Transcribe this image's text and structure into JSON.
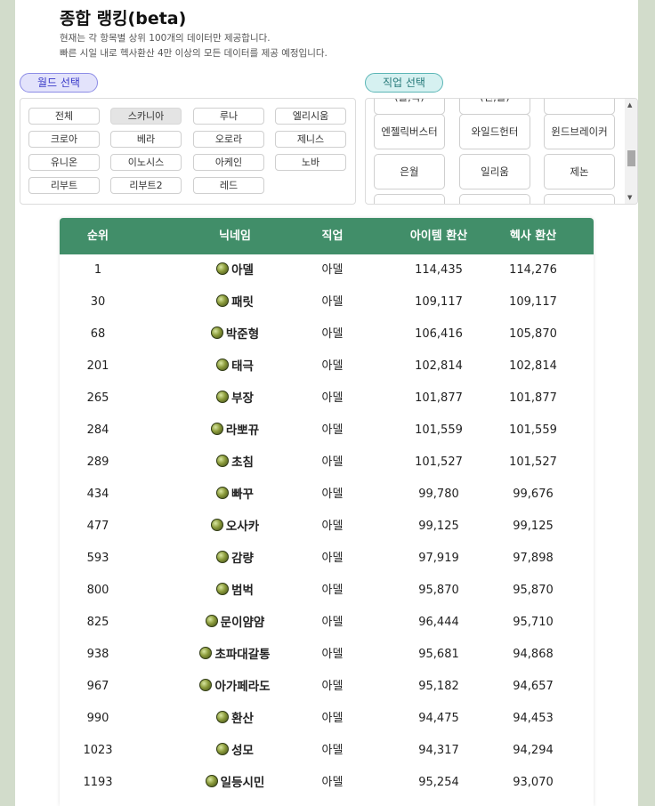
{
  "header": {
    "title": "종합 랭킹(beta)",
    "subtitle_line1": "현재는 각 항목별 상위 100개의 데이터만 제공합니다.",
    "subtitle_line2": "빠른 시일 내로 헥사환산 4만 이상의 모든 데이터를 제공 예정입니다."
  },
  "world_filter": {
    "label": "월드 선택",
    "selected": "스카니아",
    "items": [
      "전체",
      "스카니아",
      "루나",
      "엘리시움",
      "크로아",
      "베라",
      "오로라",
      "제니스",
      "유니온",
      "이노시스",
      "아케인",
      "노바",
      "리부트",
      "리부트2",
      "레드"
    ]
  },
  "job_filter": {
    "label": "직업 선택",
    "items": [
      "(불,독)",
      "(썬,콜)",
      "",
      "엔젤릭버스터",
      "와일드헌터",
      "윈드브레이커",
      "은월",
      "일리움",
      "제논"
    ]
  },
  "table": {
    "headers": {
      "rank": "순위",
      "nickname": "닉네임",
      "job": "직업",
      "item_conversion": "아이템 환산",
      "hexa_conversion": "헥사 환산"
    },
    "rows": [
      {
        "rank": "1",
        "nickname": "아델",
        "job": "아델",
        "item": "114,435",
        "hexa": "114,276"
      },
      {
        "rank": "30",
        "nickname": "패릿",
        "job": "아델",
        "item": "109,117",
        "hexa": "109,117"
      },
      {
        "rank": "68",
        "nickname": "박준형",
        "job": "아델",
        "item": "106,416",
        "hexa": "105,870"
      },
      {
        "rank": "201",
        "nickname": "태극",
        "job": "아델",
        "item": "102,814",
        "hexa": "102,814"
      },
      {
        "rank": "265",
        "nickname": "부장",
        "job": "아델",
        "item": "101,877",
        "hexa": "101,877"
      },
      {
        "rank": "284",
        "nickname": "라뽀뀨",
        "job": "아델",
        "item": "101,559",
        "hexa": "101,559"
      },
      {
        "rank": "289",
        "nickname": "초침",
        "job": "아델",
        "item": "101,527",
        "hexa": "101,527"
      },
      {
        "rank": "434",
        "nickname": "빠꾸",
        "job": "아델",
        "item": "99,780",
        "hexa": "99,676"
      },
      {
        "rank": "477",
        "nickname": "오사카",
        "job": "아델",
        "item": "99,125",
        "hexa": "99,125"
      },
      {
        "rank": "593",
        "nickname": "감량",
        "job": "아델",
        "item": "97,919",
        "hexa": "97,898"
      },
      {
        "rank": "800",
        "nickname": "범벅",
        "job": "아델",
        "item": "95,870",
        "hexa": "95,870"
      },
      {
        "rank": "825",
        "nickname": "문이얌얌",
        "job": "아델",
        "item": "96,444",
        "hexa": "95,710"
      },
      {
        "rank": "938",
        "nickname": "초파대갈통",
        "job": "아델",
        "item": "95,681",
        "hexa": "94,868"
      },
      {
        "rank": "967",
        "nickname": "아가페라도",
        "job": "아델",
        "item": "95,182",
        "hexa": "94,657"
      },
      {
        "rank": "990",
        "nickname": "환산",
        "job": "아델",
        "item": "94,475",
        "hexa": "94,453"
      },
      {
        "rank": "1023",
        "nickname": "성모",
        "job": "아델",
        "item": "94,317",
        "hexa": "94,294"
      },
      {
        "rank": "1193",
        "nickname": "일등시민",
        "job": "아델",
        "item": "95,254",
        "hexa": "93,070"
      }
    ]
  }
}
